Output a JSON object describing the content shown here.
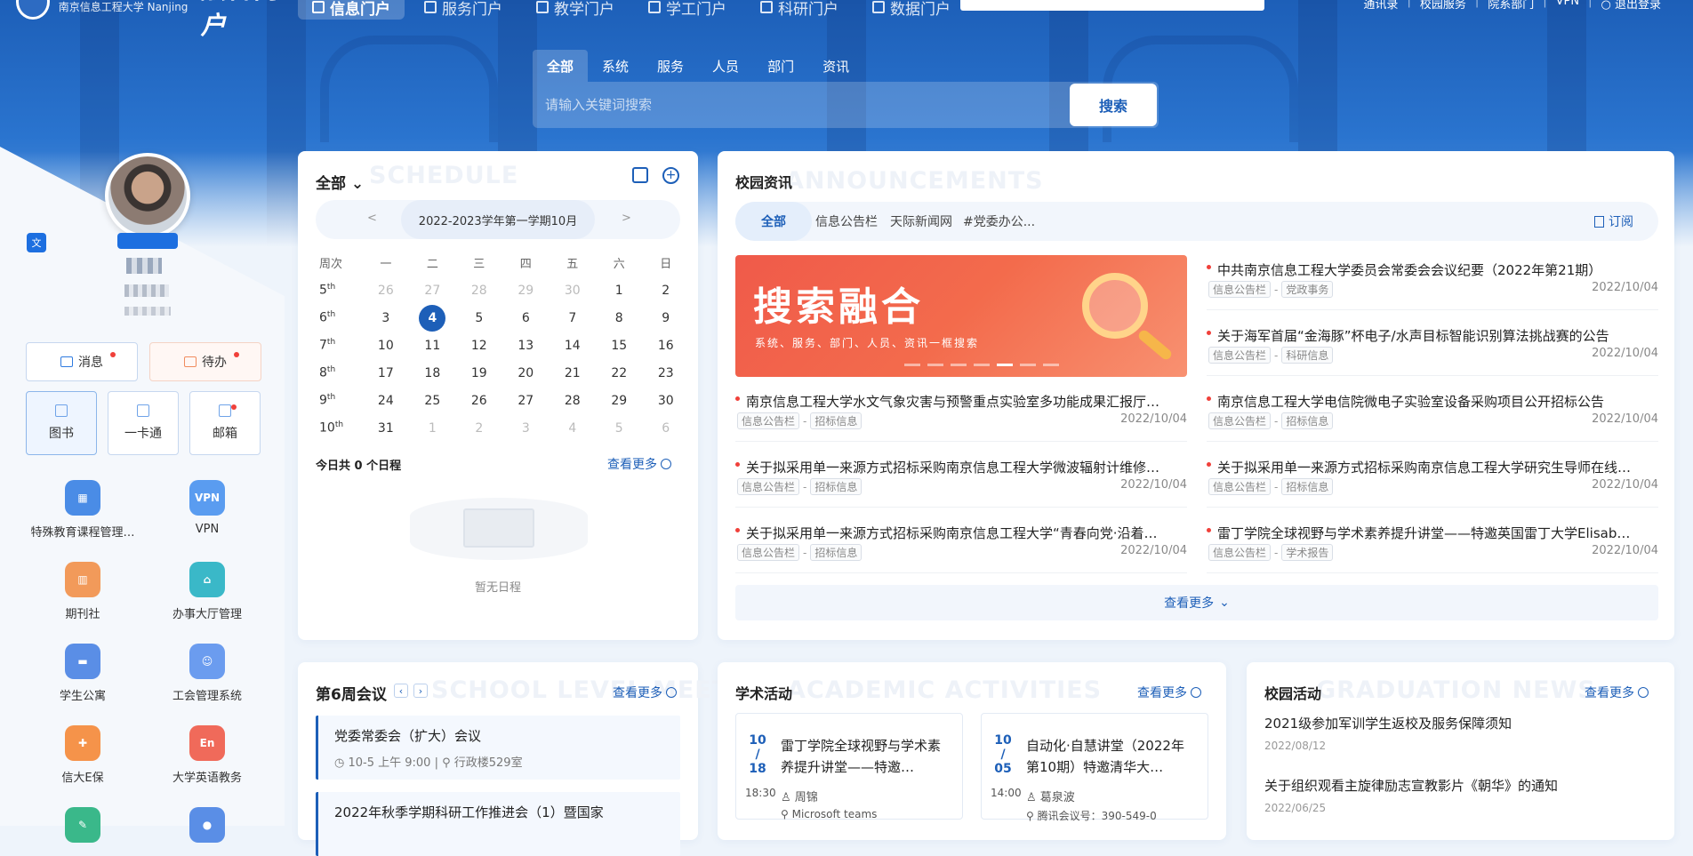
{
  "header": {
    "school_name": "南京信息工程大学 Nanjing University of Information Science & Technology",
    "brand": "融合门户",
    "nav": [
      {
        "label": "信息门户",
        "active": true
      },
      {
        "label": "服务门户",
        "active": false
      },
      {
        "label": "教学门户",
        "active": false
      },
      {
        "label": "学工门户",
        "active": false
      },
      {
        "label": "科研门户",
        "active": false
      },
      {
        "label": "数据门户",
        "active": false
      }
    ],
    "links": [
      "通讯录",
      "校园服务",
      "院系部门",
      "VPN",
      "退出登录"
    ]
  },
  "search": {
    "tabs": [
      "全部",
      "系统",
      "服务",
      "人员",
      "部门",
      "资讯"
    ],
    "placeholder": "请输入关键词搜索",
    "button": "搜索"
  },
  "sidebar": {
    "message_label": "消息",
    "todo_label": "待办",
    "quick": [
      "图书",
      "一卡通",
      "邮箱"
    ],
    "apps": [
      {
        "label": "特殊教育课程管理…",
        "icon": "course-icon",
        "color": "#4a8ce6"
      },
      {
        "label": "VPN",
        "icon": "vpn-icon",
        "color": "#5a9cf0"
      },
      {
        "label": "期刊社",
        "icon": "books-icon",
        "color": "#f29a5a"
      },
      {
        "label": "办事大厅管理",
        "icon": "service-hall-icon",
        "color": "#3ab8c8"
      },
      {
        "label": "学生公寓",
        "icon": "bed-icon",
        "color": "#5a8ee6"
      },
      {
        "label": "工会管理系统",
        "icon": "people-icon",
        "color": "#6b9cef"
      },
      {
        "label": "信大E保",
        "icon": "medkit-icon",
        "color": "#f5934a"
      },
      {
        "label": "大学英语教务",
        "icon": "english-icon",
        "color": "#f06a5a"
      }
    ]
  },
  "calendar": {
    "title": "全部",
    "ghost": "SCHEDULE",
    "term": "2022-2023学年第一学期10月",
    "prev": "<",
    "next": ">",
    "headers": [
      "周次",
      "一",
      "二",
      "三",
      "四",
      "五",
      "六",
      "日"
    ],
    "weeks": [
      {
        "w": "5",
        "days": [
          "26",
          "27",
          "28",
          "29",
          "30",
          "1",
          "2"
        ]
      },
      {
        "w": "6",
        "days": [
          "3",
          "4",
          "5",
          "6",
          "7",
          "8",
          "9"
        ]
      },
      {
        "w": "7",
        "days": [
          "10",
          "11",
          "12",
          "13",
          "14",
          "15",
          "16"
        ]
      },
      {
        "w": "8",
        "days": [
          "17",
          "18",
          "19",
          "20",
          "21",
          "22",
          "23"
        ]
      },
      {
        "w": "9",
        "days": [
          "24",
          "25",
          "26",
          "27",
          "28",
          "29",
          "30"
        ]
      },
      {
        "w": "10",
        "days": [
          "31",
          "1",
          "2",
          "3",
          "4",
          "5",
          "6"
        ]
      }
    ],
    "today_summary": "今日共 0 个日程",
    "more": "查看更多",
    "empty": "暂无日程"
  },
  "news": {
    "title": "校园资讯",
    "ghost": "ANNOUNCEMENTS",
    "tabs": [
      "全部",
      "信息公告栏",
      "天际新闻网",
      "#党委办公..."
    ],
    "subscribe": "订阅",
    "banner_big": "搜索融合",
    "banner_small": "系统、服务、部门、人员、资讯一框搜索",
    "items": [
      {
        "title": "中共南京信息工程大学委员会常委会会议纪要（2022年第21期）",
        "tag1": "信息公告栏",
        "tag2": "党政事务",
        "date": "2022/10/04"
      },
      {
        "title": "关于海军首届“金海豚”杯电子/水声目标智能识别算法挑战赛的公告",
        "tag1": "信息公告栏",
        "tag2": "科研信息",
        "date": "2022/10/04"
      },
      {
        "title": "南京信息工程大学水文气象灾害与预警重点实验室多功能成果汇报厅…",
        "tag1": "信息公告栏",
        "tag2": "招标信息",
        "date": "2022/10/04"
      },
      {
        "title": "南京信息工程大学电信院微电子实验室设备采购项目公开招标公告",
        "tag1": "信息公告栏",
        "tag2": "招标信息",
        "date": "2022/10/04"
      },
      {
        "title": "关于拟采用单一来源方式招标采购南京信息工程大学微波辐射计维修…",
        "tag1": "信息公告栏",
        "tag2": "招标信息",
        "date": "2022/10/04"
      },
      {
        "title": "关于拟采用单一来源方式招标采购南京信息工程大学研究生导师在线…",
        "tag1": "信息公告栏",
        "tag2": "招标信息",
        "date": "2022/10/04"
      },
      {
        "title": "关于拟采用单一来源方式招标采购南京信息工程大学“青春向党·沿着…",
        "tag1": "信息公告栏",
        "tag2": "招标信息",
        "date": "2022/10/04"
      },
      {
        "title": "雷丁学院全球视野与学术素养提升讲堂——特邀英国雷丁大学Elisab…",
        "tag1": "信息公告栏",
        "tag2": "学术报告",
        "date": "2022/10/04"
      }
    ],
    "more": "查看更多"
  },
  "meetings": {
    "title": "第6周会议",
    "ghost": "SCHOOL LEVEL MEETING",
    "more": "查看更多",
    "items": [
      {
        "title": "党委常委会（扩大）会议",
        "time": "10-5 上午 9:00",
        "place": "行政楼529室"
      },
      {
        "title": "2022年秋季学期科研工作推进会（1）暨国家",
        "time": "",
        "place": ""
      }
    ]
  },
  "academic": {
    "title": "学术活动",
    "ghost": "ACADEMIC ACTIVITIES",
    "more": "查看更多",
    "items": [
      {
        "m": "10",
        "d": "18",
        "time": "18:30",
        "title": "雷丁学院全球视野与学术素养提升讲堂——特邀…",
        "person": "周锦",
        "loc": "Microsoft teams"
      },
      {
        "m": "10",
        "d": "05",
        "time": "14:00",
        "title": "自动化·自慧讲堂（2022年第10期）特邀清华大…",
        "person": "葛泉波",
        "loc": "腾讯会议号：390-549-0"
      }
    ]
  },
  "campus": {
    "title": "校园活动",
    "ghost": "GRADUATION NEWS",
    "more": "查看更多",
    "items": [
      {
        "title": "2021级参加军训学生返校及服务保障须知",
        "date": "2022/08/12"
      },
      {
        "title": "关于组织观看主旋律励志宣教影片《朝华》的通知",
        "date": "2022/06/25"
      }
    ]
  }
}
